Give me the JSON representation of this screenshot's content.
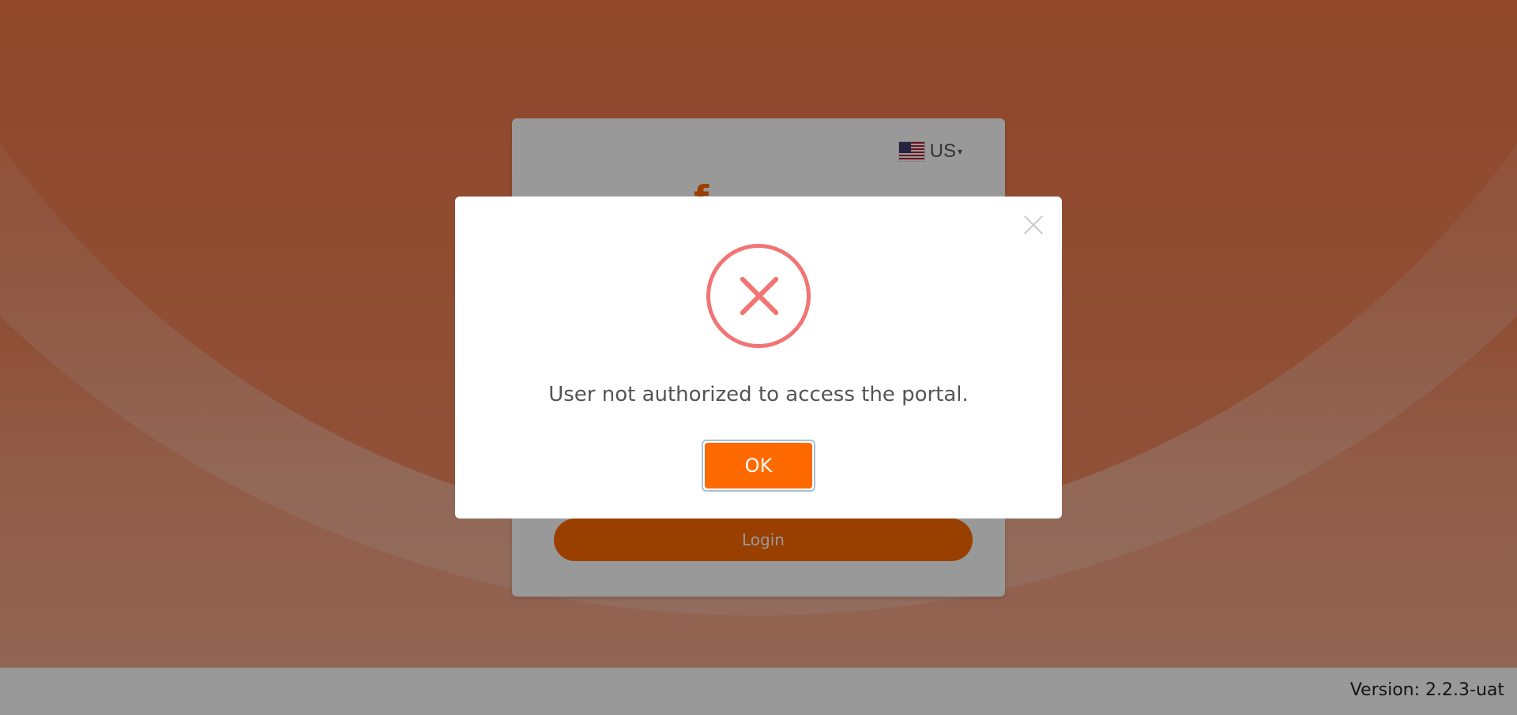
{
  "login_card": {
    "language": {
      "flag_icon": "us-flag-icon",
      "label": "US",
      "caret": "▾"
    },
    "logo_fragment": "f",
    "login_button": "Login"
  },
  "footer": {
    "version": "Version: 2.2.3-uat"
  },
  "modal": {
    "icon": "error-x-icon",
    "message": "User not authorized to access the portal.",
    "ok_label": "OK",
    "close_icon": "close-icon"
  },
  "colors": {
    "brand_orange": "#ff6a00",
    "error_red": "#f27474",
    "message_gray": "#545454"
  }
}
